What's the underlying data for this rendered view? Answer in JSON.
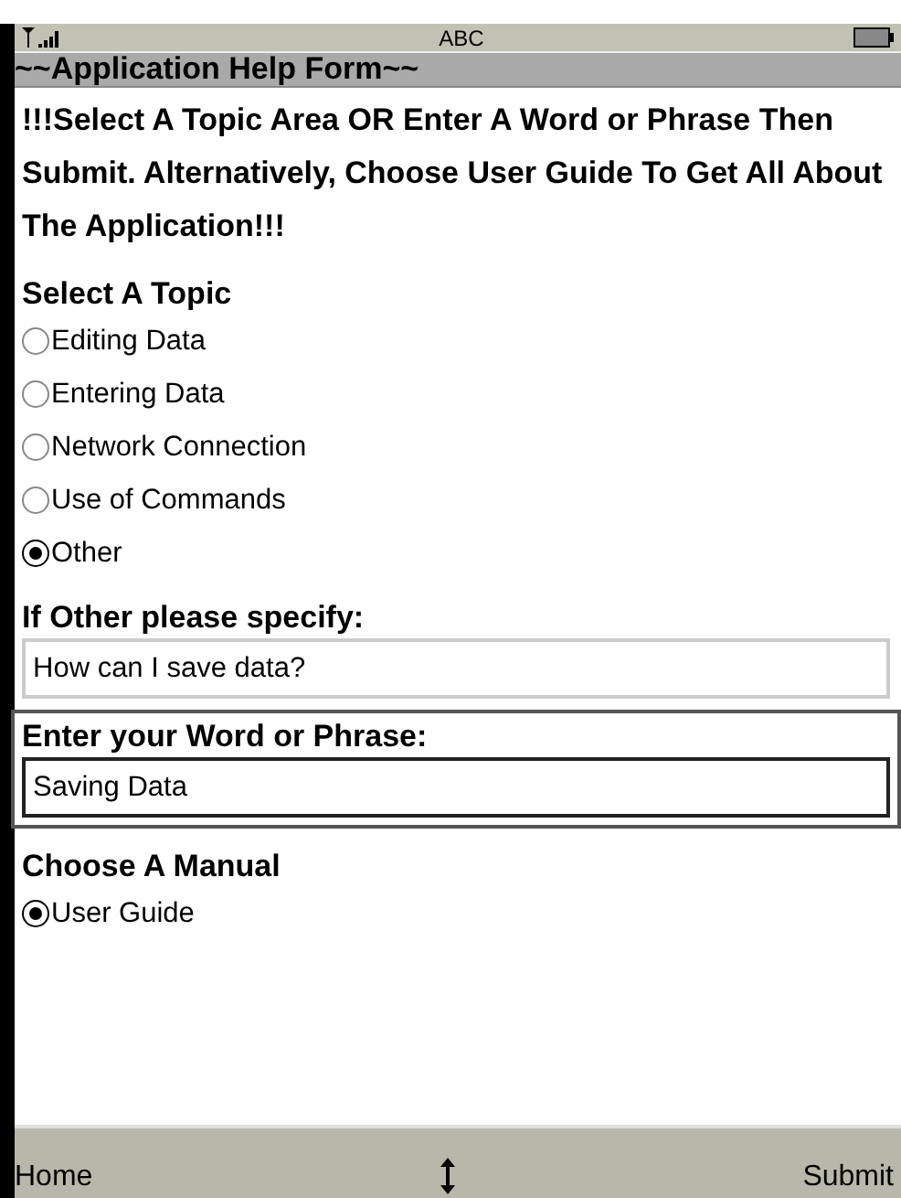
{
  "status_bar": {
    "input_mode": "ABC"
  },
  "title": "~~Application Help Form~~",
  "instructions": "!!!Select A Topic Area OR Enter A Word or Phrase Then Submit. Alternatively, Choose User Guide To Get All About The Application!!!",
  "topic": {
    "label": "Select A Topic",
    "options": [
      {
        "label": "Editing Data",
        "selected": false
      },
      {
        "label": "Entering Data",
        "selected": false
      },
      {
        "label": "Network Connection",
        "selected": false
      },
      {
        "label": "Use of Commands",
        "selected": false
      },
      {
        "label": "Other",
        "selected": true
      }
    ]
  },
  "other_field": {
    "label": "If Other please specify:",
    "value": "How can I save data?",
    "focused": false
  },
  "phrase_field": {
    "label": "Enter your Word or Phrase:",
    "value": "Saving Data",
    "focused": true
  },
  "manual": {
    "label": "Choose A Manual",
    "options": [
      {
        "label": "User Guide",
        "selected": true
      }
    ]
  },
  "softkeys": {
    "left": "Home",
    "right": "Submit"
  }
}
